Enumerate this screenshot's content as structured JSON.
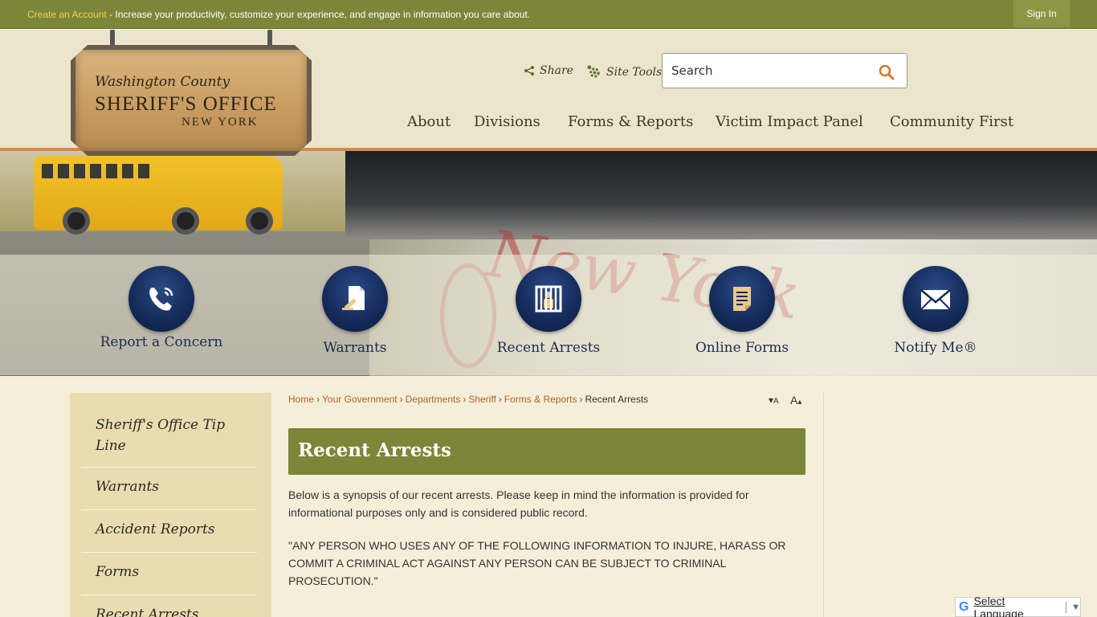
{
  "topbar": {
    "create_link": "Create an Account",
    "message": " - Increase your productivity, customize your experience, and engage in information you care about.",
    "sign_in": "Sign In"
  },
  "logo": {
    "line1": "Washington County",
    "line2": "SHERIFF'S OFFICE",
    "line3": "NEW YORK"
  },
  "tools": {
    "share": "Share",
    "site_tools": "Site Tools",
    "search_placeholder": "Search"
  },
  "nav": [
    "About",
    "Divisions",
    "Forms & Reports",
    "Victim Impact Panel",
    "Community First"
  ],
  "quick_links": [
    {
      "label": "Report a Concern",
      "icon": "phone-icon"
    },
    {
      "label": "Warrants",
      "icon": "gavel-document-icon"
    },
    {
      "label": "Recent Arrests",
      "icon": "jail-icon"
    },
    {
      "label": "Online Forms",
      "icon": "form-icon"
    },
    {
      "label": "Notify Me®",
      "icon": "envelope-icon"
    }
  ],
  "banner_text": "New York",
  "sidebar": [
    "Sheriff's Office Tip Line",
    "Warrants",
    "Accident Reports",
    "Forms",
    "Recent Arrests"
  ],
  "breadcrumb": {
    "links": [
      "Home",
      "Your Government",
      "Departments",
      "Sheriff",
      "Forms & Reports"
    ],
    "current": "Recent Arrests",
    "separator": "›"
  },
  "font_resize": {
    "decrease": "A",
    "increase": "A"
  },
  "page": {
    "title": "Recent Arrests",
    "para1": "Below is a synopsis of our recent arrests. Please keep in mind the information is provided for informational purposes only and is considered public record.",
    "para2": "\"ANY PERSON WHO USES ANY OF THE FOLLOWING INFORMATION TO INJURE, HARASS OR COMMIT A CRIMINAL ACT AGAINST ANY PERSON CAN BE SUBJECT TO CRIMINAL PROSECUTION.\""
  },
  "translate": {
    "label": "Select Language",
    "g": "G"
  },
  "colors": {
    "accent_green": "#7b8638",
    "link_orange": "#b0602a",
    "navy": "#142a58"
  }
}
